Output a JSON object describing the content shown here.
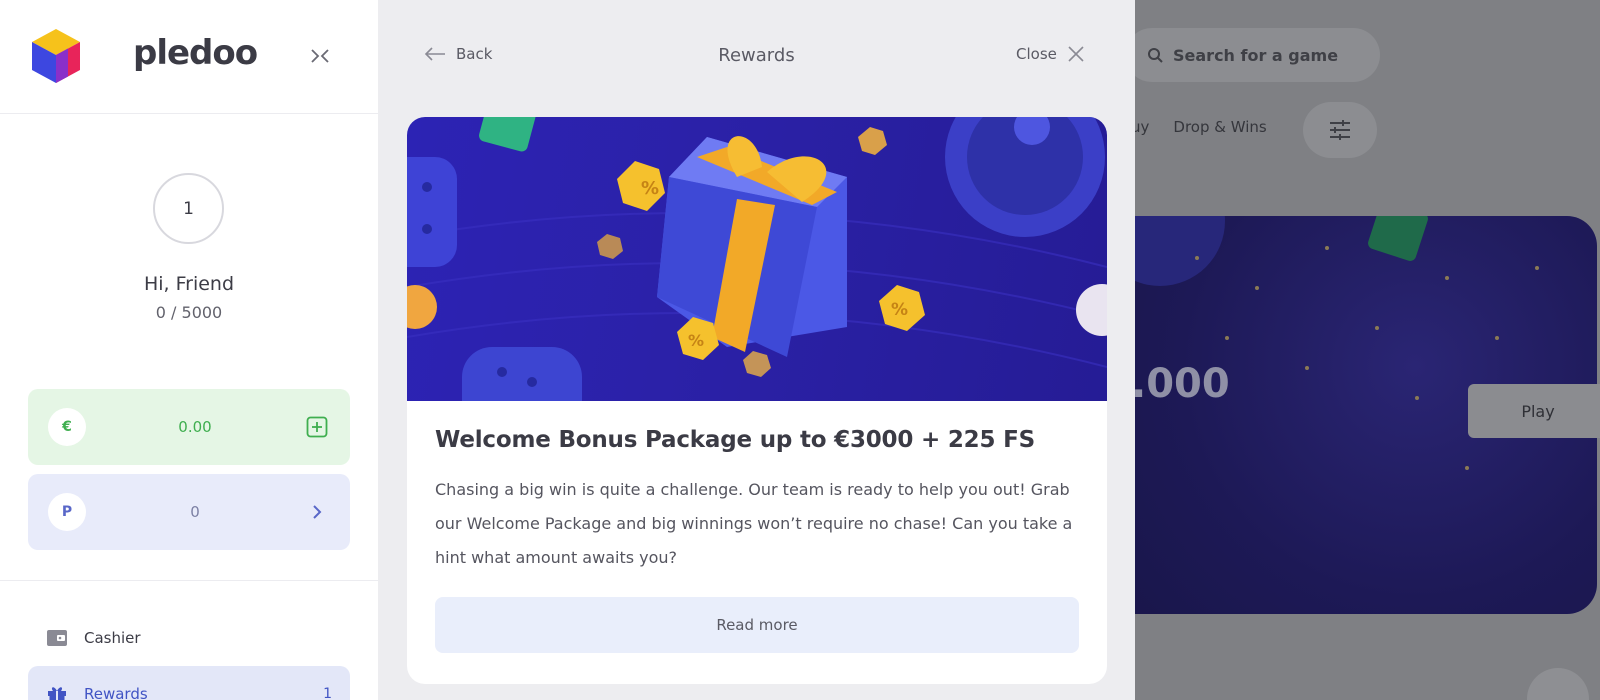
{
  "sidebar": {
    "brand": "pledoo",
    "user": {
      "level": "1",
      "greeting": "Hi, Friend",
      "progress": "0 /  5000"
    },
    "balance": {
      "currency_symbol": "€",
      "amount": "0.00"
    },
    "points": {
      "symbol": "P",
      "amount": "0"
    },
    "nav": [
      {
        "label": "Cashier",
        "icon": "wallet-icon"
      },
      {
        "label": "Rewards",
        "icon": "gift-icon",
        "count": "1"
      }
    ]
  },
  "modal": {
    "back_label": "Back",
    "title": "Rewards",
    "close_label": "Close",
    "card": {
      "title": "Welcome Bonus Package up to €3000 + 225 FS",
      "text": "Chasing a big win is quite a challenge. Our team is ready to help you out! Grab our Welcome Package and big winnings won’t require no chase! Can you take a hint what amount awaits you?",
      "button": "Read more",
      "banner_symbols": [
        "%",
        "%",
        "%"
      ]
    }
  },
  "background": {
    "search_placeholder": "Search for a game",
    "categories": [
      "uy",
      "Drop & Wins"
    ],
    "hero_amount": ".000",
    "play_label": "Play"
  },
  "colors": {
    "accent_blue": "#4154c4",
    "money_green": "#3fae4f",
    "banner_blue": "#2b21a8"
  }
}
